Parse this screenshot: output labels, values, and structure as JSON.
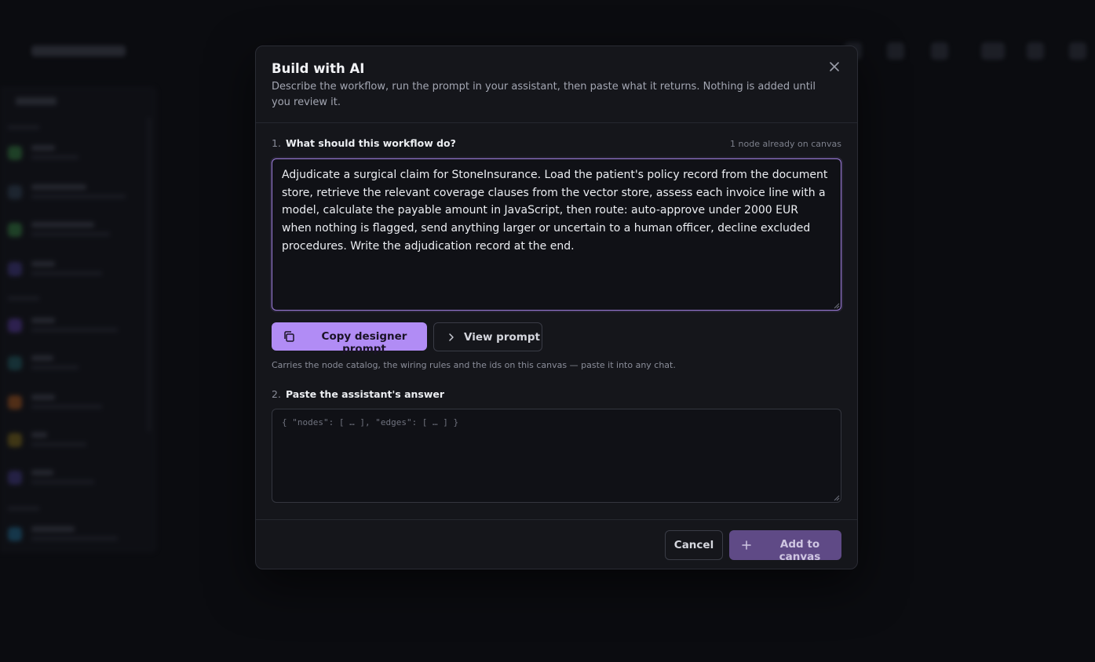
{
  "modal": {
    "title": "Build with AI",
    "description": "Describe the workflow, run the prompt in your assistant, then paste what it returns. Nothing is added until you review it.",
    "step1": {
      "number": "1.",
      "label": "What should this workflow do?"
    },
    "node_count": "1 node already on canvas",
    "workflow_text": "Adjudicate a surgical claim for StoneInsurance. Load the patient's policy record from the document store, retrieve the relevant coverage clauses from the vector store, assess each invoice line with a model, calculate the payable amount in JavaScript, then route: auto-approve under 2000 EUR when nothing is flagged, send anything larger or uncertain to a human officer, decline excluded procedures. Write the adjudication record at the end.",
    "copy_button": "Copy designer prompt",
    "view_button": "View prompt",
    "hint": "Carries the node catalog, the wiring rules and the ids on this canvas — paste it into any chat.",
    "step2": {
      "number": "2.",
      "label": "Paste the assistant's answer"
    },
    "answer_placeholder": "{ \"nodes\": [ … ], \"edges\": [ … ] }",
    "cancel_button": "Cancel",
    "add_button": "Add to canvas"
  },
  "icons": {
    "close": "close-icon",
    "copy": "copy-icon",
    "view": "chevron-right-icon",
    "add": "plus-icon"
  },
  "colors": {
    "accent": "#b18cf5",
    "accent_muted": "#5f4a86",
    "focus_border": "#9b7bd8",
    "surface": "#15161b",
    "backdrop": "#0b0c10"
  }
}
